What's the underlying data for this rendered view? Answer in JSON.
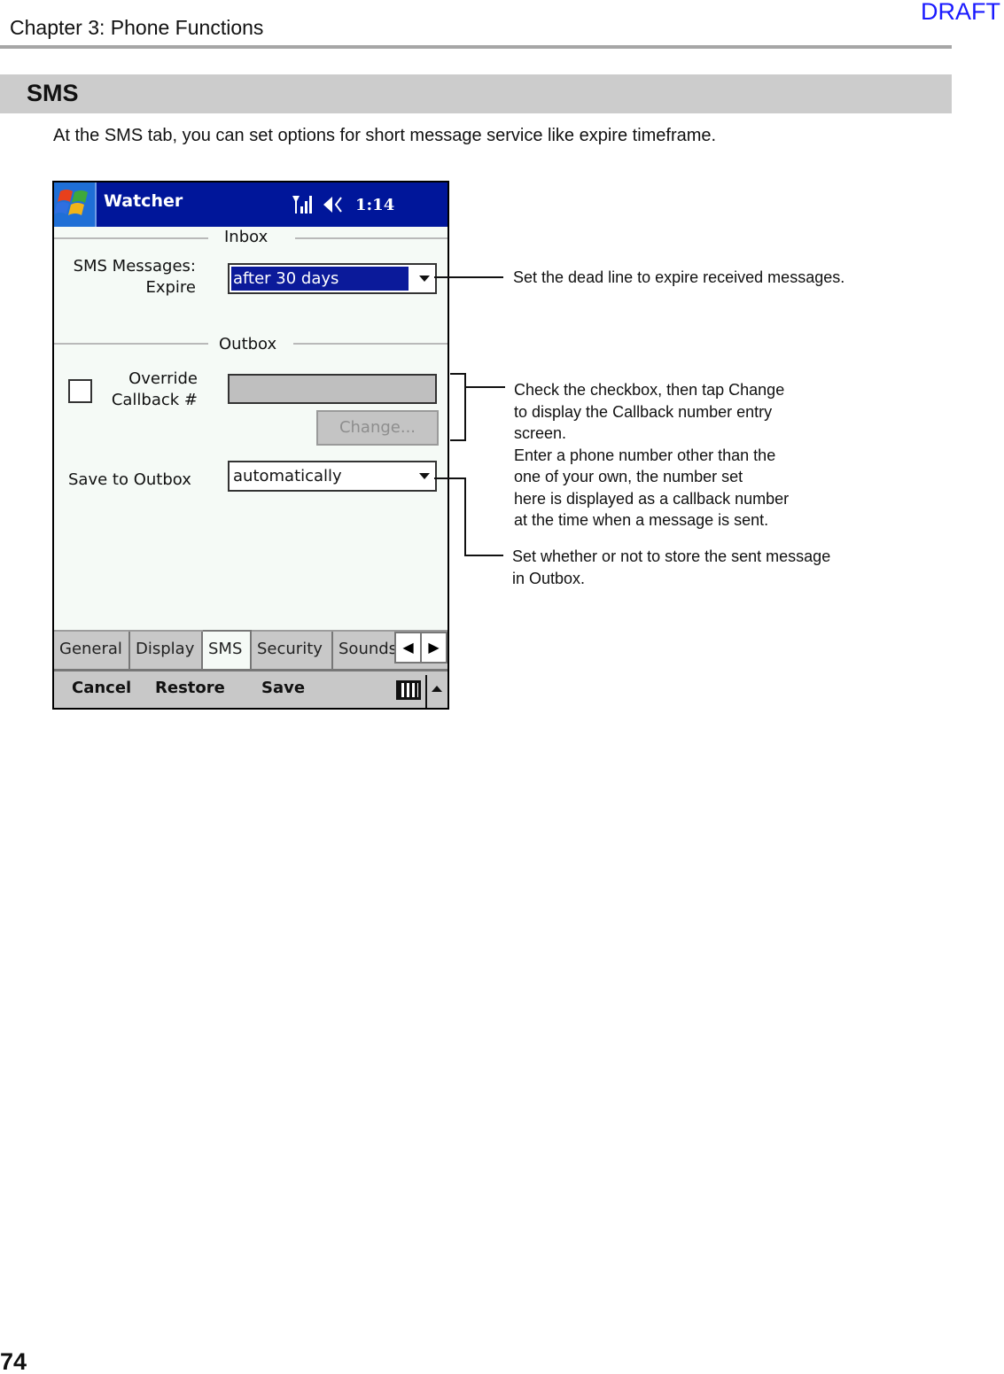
{
  "watermark": "DRAFT",
  "header": {
    "chapter": "Chapter 3: Phone Functions"
  },
  "section": {
    "title": "SMS",
    "intro": "At the SMS tab, you can set options for short message service like expire timeframe."
  },
  "device": {
    "titlebar": {
      "start_icon": "windows-flag-icon",
      "app_title": "Watcher",
      "signal_icon": "signal-strength-icon",
      "volume_icon": "speaker-icon",
      "time": "1:14"
    },
    "inbox": {
      "group_label": "Inbox",
      "expire_label_line1": "SMS Messages:",
      "expire_label_line2": "Expire",
      "expire_value": "after 30 days"
    },
    "outbox": {
      "group_label": "Outbox",
      "override_label_line1": "Override",
      "override_label_line2": "Callback #",
      "override_checked": false,
      "callback_number": "",
      "change_button": "Change...",
      "save_label": "Save to Outbox",
      "save_value": "automatically"
    },
    "tabs": [
      {
        "label": "General",
        "active": false
      },
      {
        "label": "Display",
        "active": false
      },
      {
        "label": "SMS",
        "active": true
      },
      {
        "label": "Security",
        "active": false
      },
      {
        "label": "Sounds",
        "active": false
      }
    ],
    "tab_scroll": {
      "left": "◀",
      "right": "▶"
    },
    "menubar": {
      "cancel": "Cancel",
      "restore": "Restore",
      "save": "Save",
      "keyboard_icon": "keyboard-icon",
      "sip_arrow_icon": "up-arrow-icon"
    }
  },
  "callouts": [
    {
      "lines": [
        "Set the dead line to expire received messages."
      ]
    },
    {
      "lines": [
        "Check the checkbox, then tap Change",
        "to display the Callback number entry",
        "screen.",
        "Enter a phone number other than the",
        "one of your own, the number set",
        "here is displayed as a callback number",
        "at the time when a message is sent."
      ]
    },
    {
      "lines": [
        "Set whether or not to store the sent message",
        "in Outbox."
      ]
    }
  ],
  "page_number": "74"
}
